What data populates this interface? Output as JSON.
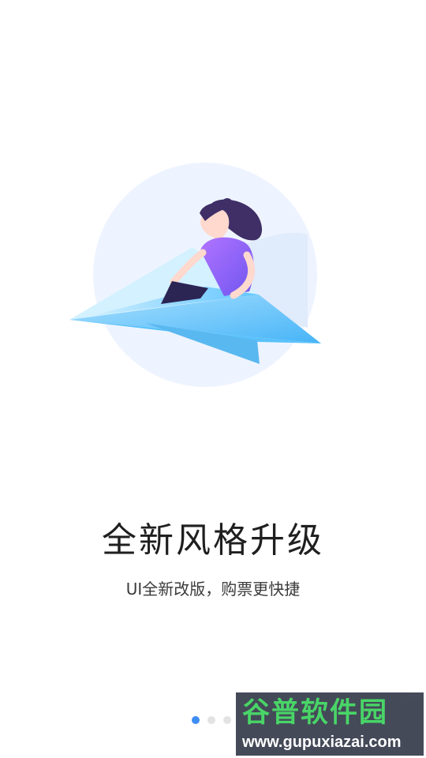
{
  "onboarding": {
    "title": "全新风格升级",
    "subtitle": "UI全新改版，购票更快捷",
    "page_indicator": {
      "total": 3,
      "active_index": 0
    }
  },
  "watermark": {
    "name": "谷普软件园",
    "url": "www.gupuxiazai.com"
  },
  "colors": {
    "background": "#ffffff",
    "indicator_active": "#3e8df3",
    "indicator_inactive": "#e3e3e3",
    "illustration_circle": "#e9f1ff",
    "plane_blue": "#4eb8f8",
    "character_purple": "#8e5bf0"
  }
}
